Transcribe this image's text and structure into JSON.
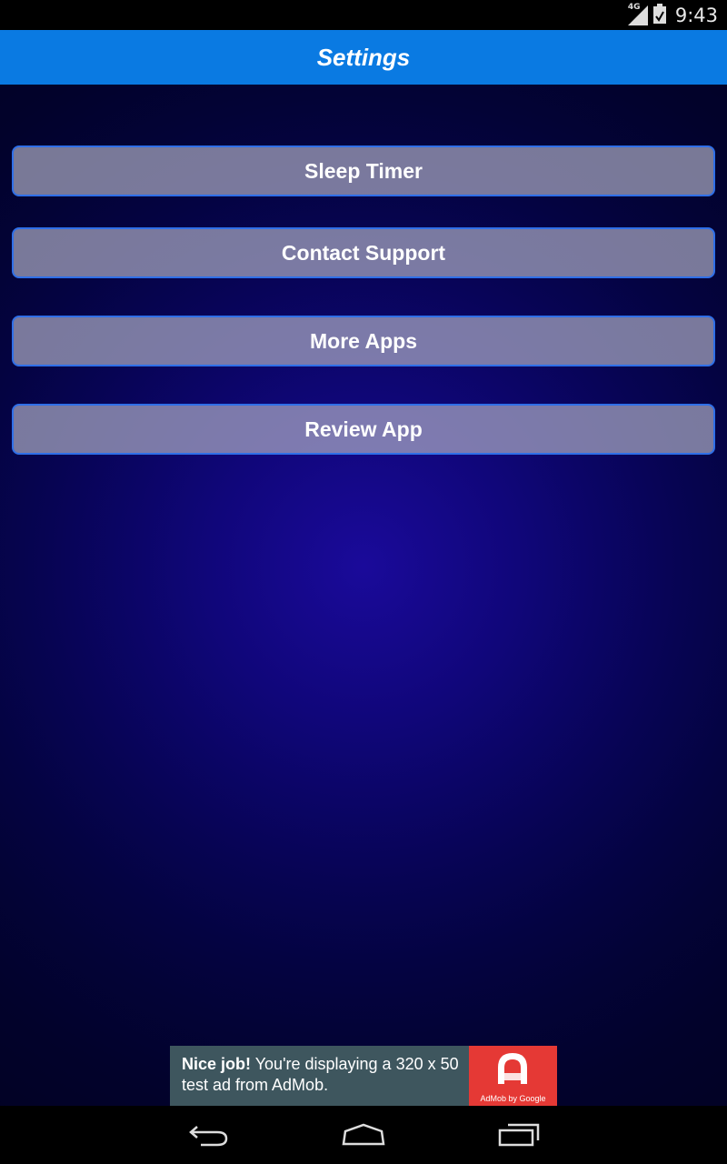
{
  "status_bar": {
    "network": "4G",
    "time": "9:43",
    "icons": [
      "signal-icon",
      "battery-icon"
    ]
  },
  "app_bar": {
    "title": "Settings",
    "color": "#0a7ae2"
  },
  "menu": {
    "items": [
      {
        "label": "Sleep Timer"
      },
      {
        "label": "Contact Support"
      },
      {
        "label": "More Apps"
      },
      {
        "label": "Review App"
      }
    ]
  },
  "ad": {
    "headline": "Nice job!",
    "body": " You're displaying a 320 x 50 test ad from AdMob.",
    "brand": "AdMob by Google",
    "accent": "#e53935"
  },
  "nav_bar": {
    "icons": [
      "back-icon",
      "home-icon",
      "recents-icon"
    ]
  }
}
